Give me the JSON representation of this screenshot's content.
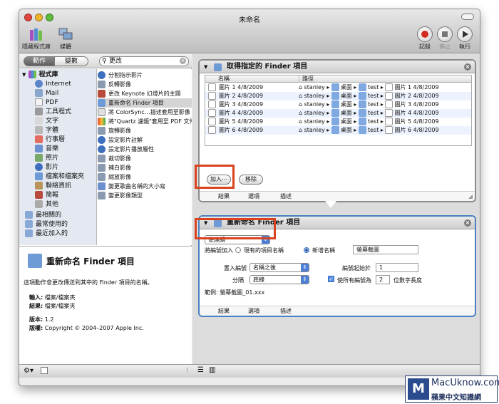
{
  "window": {
    "title": "未命名"
  },
  "toolbar": {
    "library_label": "隱藏程式庫",
    "media_label": "媒體",
    "record_label": "記錄",
    "stop_label": "停止",
    "run_label": "執行"
  },
  "left": {
    "actions_tab": "動作",
    "variables_tab": "變數",
    "search_value": "更改",
    "library_root": "程式庫",
    "library": [
      "Internet",
      "Mail",
      "PDF",
      "工具程式",
      "文字",
      "字體",
      "行事曆",
      "音樂",
      "照片",
      "影片",
      "檔案和檔案夾",
      "聯絡資訊",
      "簡報",
      "其他"
    ],
    "smart": [
      "最相關的",
      "最常使用的",
      "最近加入的"
    ],
    "actions": [
      "分割指示影片",
      "反轉影像",
      "更改 Keynote 幻燈片的主題",
      "重新命名 Finder 項目",
      "將 ColorSync…描述套用至影像",
      "將\"Quartz 濾鏡\"套用至 PDF 文件",
      "旋轉影像",
      "設定影片註解",
      "設定影片播放屬性",
      "裁切影像",
      "補白影像",
      "縮放影像",
      "變更歌曲名稱的大小寫",
      "變更影像類型"
    ],
    "selected_action": "重新命名 Finder 項目"
  },
  "description": {
    "title": "重新命名 Finder 項目",
    "text": "這項動作會更改傳送到其中的 Finder 項目的名稱。",
    "input_label": "輸入:",
    "input_value": "檔案/檔案夾",
    "result_label": "結果:",
    "result_value": "檔案/檔案夾",
    "version_label": "版本:",
    "version_value": "1.2",
    "copyright_label": "版權:",
    "copyright_value": "Copyright © 2004–2007 Apple Inc."
  },
  "panel1": {
    "title": "取得指定的 Finder 項目",
    "col_name": "名稱",
    "col_path": "路徑",
    "rows": [
      {
        "name": "圖片 1 4/8/2009",
        "user": "stanley",
        "desktop": "桌面",
        "folder": "test",
        "file": "圖片 1 4/8/2009"
      },
      {
        "name": "圖片 2 4/8/2009",
        "user": "stanley",
        "desktop": "桌面",
        "folder": "test",
        "file": "圖片 2 4/8/2009"
      },
      {
        "name": "圖片 3 4/8/2009",
        "user": "stanley",
        "desktop": "桌面",
        "folder": "test",
        "file": "圖片 3 4/8/2009"
      },
      {
        "name": "圖片 4 4/8/2009",
        "user": "stanley",
        "desktop": "桌面",
        "folder": "test",
        "file": "圖片 4 4/8/2009"
      },
      {
        "name": "圖片 5 4/8/2009",
        "user": "stanley",
        "desktop": "桌面",
        "folder": "test",
        "file": "圖片 5 4/8/2009"
      },
      {
        "name": "圖片 6 4/8/2009",
        "user": "stanley",
        "desktop": "桌面",
        "folder": "test",
        "file": "圖片 6 4/8/2009"
      }
    ],
    "add_button": "加入⋯",
    "remove_button": "移除",
    "tab_results": "結果",
    "tab_options": "選項",
    "tab_description": "描述"
  },
  "panel2": {
    "title": "重新命名 Finder 項目",
    "mode_select": "使連續",
    "add_number_to": "將編號加入",
    "radio_existing": "現有的項目名稱",
    "radio_new": "新增名稱",
    "new_name_value": "螢幕截圖",
    "place_number_label": "置入編號",
    "place_number_value": "名稱之後",
    "start_at_label": "編號起始於",
    "start_at_value": "1",
    "separator_label": "分隔",
    "separator_value": "底線",
    "all_numbers_label": "使所有編號為",
    "digits_value": "2",
    "digits_suffix": "位數字長度",
    "example_label": "範例:",
    "example_value": "螢幕截圖_01.xxx",
    "tab_results": "結果",
    "tab_options": "選項",
    "tab_description": "描述"
  },
  "watermark": {
    "brand": "MacUknow.com",
    "tagline": "蘋果中文知識網"
  }
}
